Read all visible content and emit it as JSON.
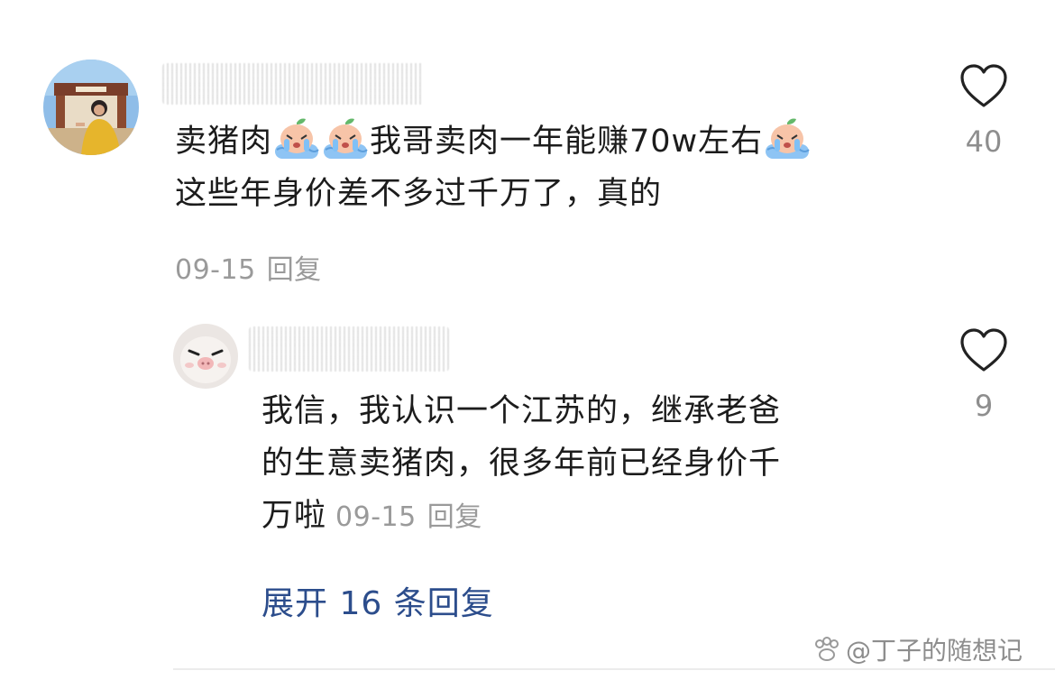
{
  "comment": {
    "text_line_1_a": "卖猪肉",
    "text_line_1_b": "我哥卖肉一年能赚70w左右",
    "text_line_2": "这些年身价差不多过千万了，真的",
    "date": "09-15",
    "reply_label": "回复",
    "like_count": "40",
    "emoji_icon": "crying-peach-emoji"
  },
  "reply": {
    "text_line_1": "我信，我认识一个江苏的，继承老爸",
    "text_line_2": "的生意卖猪肉，很多年前已经身价千",
    "text_line_3": "万啦",
    "date": "09-15",
    "reply_label": "回复",
    "like_count": "9"
  },
  "expand_replies_label": "展开 16 条回复",
  "watermark": "@丁子的随想记",
  "colors": {
    "text": "#1c1c1c",
    "meta": "#9a9a9a",
    "link": "#2c4d8c",
    "heart_outline": "#222222"
  }
}
